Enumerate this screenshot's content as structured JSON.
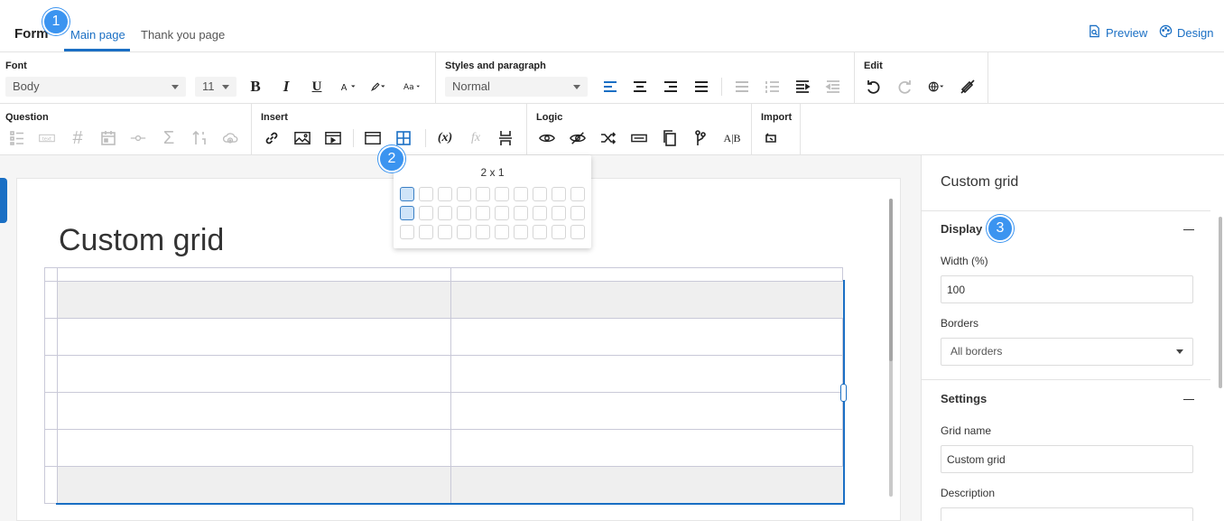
{
  "header": {
    "form_label": "Form",
    "tabs": [
      {
        "label": "Main page",
        "active": true
      },
      {
        "label": "Thank you page",
        "active": false
      }
    ],
    "actions": [
      {
        "label": "Preview",
        "icon": "preview-icon"
      },
      {
        "label": "Design",
        "icon": "palette-icon"
      }
    ]
  },
  "callouts": [
    "1",
    "2",
    "3"
  ],
  "toolbar": {
    "font": {
      "label": "Font",
      "font_family": "Body",
      "font_size": "11",
      "icons": [
        "bold-icon",
        "italic-icon",
        "underline-icon",
        "font-color-icon",
        "highlight-icon",
        "text-case-icon"
      ]
    },
    "styles": {
      "label": "Styles and paragraph",
      "style_value": "Normal",
      "icons": [
        "align-left-icon",
        "align-center-icon",
        "align-right-icon",
        "justify-icon",
        "bullet-list-icon",
        "numbered-list-icon",
        "indent-icon",
        "outdent-icon"
      ]
    },
    "edit": {
      "label": "Edit",
      "icons": [
        "undo-icon",
        "redo-icon",
        "language-icon",
        "clear-format-icon"
      ]
    },
    "question": {
      "label": "Question",
      "icons": [
        "list-icon",
        "text-field-icon",
        "number-icon",
        "date-icon",
        "slider-icon",
        "sum-icon",
        "sort-icon",
        "upload-icon"
      ],
      "text_field_glyph": "text"
    },
    "insert": {
      "label": "Insert",
      "icons": [
        "link-icon",
        "image-icon",
        "video-icon",
        "section-icon",
        "grid-icon"
      ]
    },
    "variables": {
      "icons": [
        "variable-icon",
        "formula-icon",
        "page-break-icon"
      ],
      "variable_glyph": "(x)",
      "formula_glyph": "fx"
    },
    "logic": {
      "label": "Logic",
      "icons": [
        "show-icon",
        "hide-icon",
        "shuffle-icon",
        "input-icon",
        "copy-icon",
        "branch-icon",
        "ab-test-icon"
      ],
      "ab_glyph": "A|B"
    },
    "import": {
      "label": "Import",
      "icons": [
        "import-icon"
      ]
    }
  },
  "grid_picker": {
    "label": "2 x 1",
    "cols": 10,
    "rows": 3,
    "selected_cols": 1,
    "selected_rows": 2
  },
  "canvas": {
    "title": "Custom grid"
  },
  "panel": {
    "title": "Custom grid",
    "display": {
      "title": "Display",
      "width_label": "Width (%)",
      "width_value": "100",
      "borders_label": "Borders",
      "borders_value": "All borders"
    },
    "settings": {
      "title": "Settings",
      "grid_name_label": "Grid name",
      "grid_name_value": "Custom grid",
      "description_label": "Description"
    }
  },
  "colors": {
    "accent": "#1a6fc4",
    "callout": "#3b94f0"
  }
}
